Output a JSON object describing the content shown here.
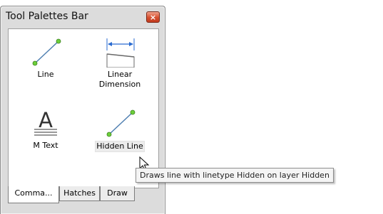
{
  "window": {
    "title": "Tool Palettes Bar",
    "close_label": "×"
  },
  "tools": [
    {
      "label": "Line",
      "icon": "line-icon"
    },
    {
      "label": "Linear\nDimension",
      "icon": "linear-dimension-icon"
    },
    {
      "label": "M Text",
      "icon": "mtext-icon",
      "glyph": "A"
    },
    {
      "label": "Hidden Line",
      "icon": "hidden-line-icon",
      "hovered": true
    }
  ],
  "tabs": [
    {
      "label": "Comma...",
      "active": true
    },
    {
      "label": "Hatches",
      "active": false
    },
    {
      "label": "Draw",
      "active": false
    }
  ],
  "tooltip": {
    "text": "Draws line with linetype Hidden on layer Hidden"
  },
  "colors": {
    "dimension_arrow": "#2a6bd1",
    "line_endpoint": "#6ccf3a",
    "close_button": "#d6502f"
  }
}
